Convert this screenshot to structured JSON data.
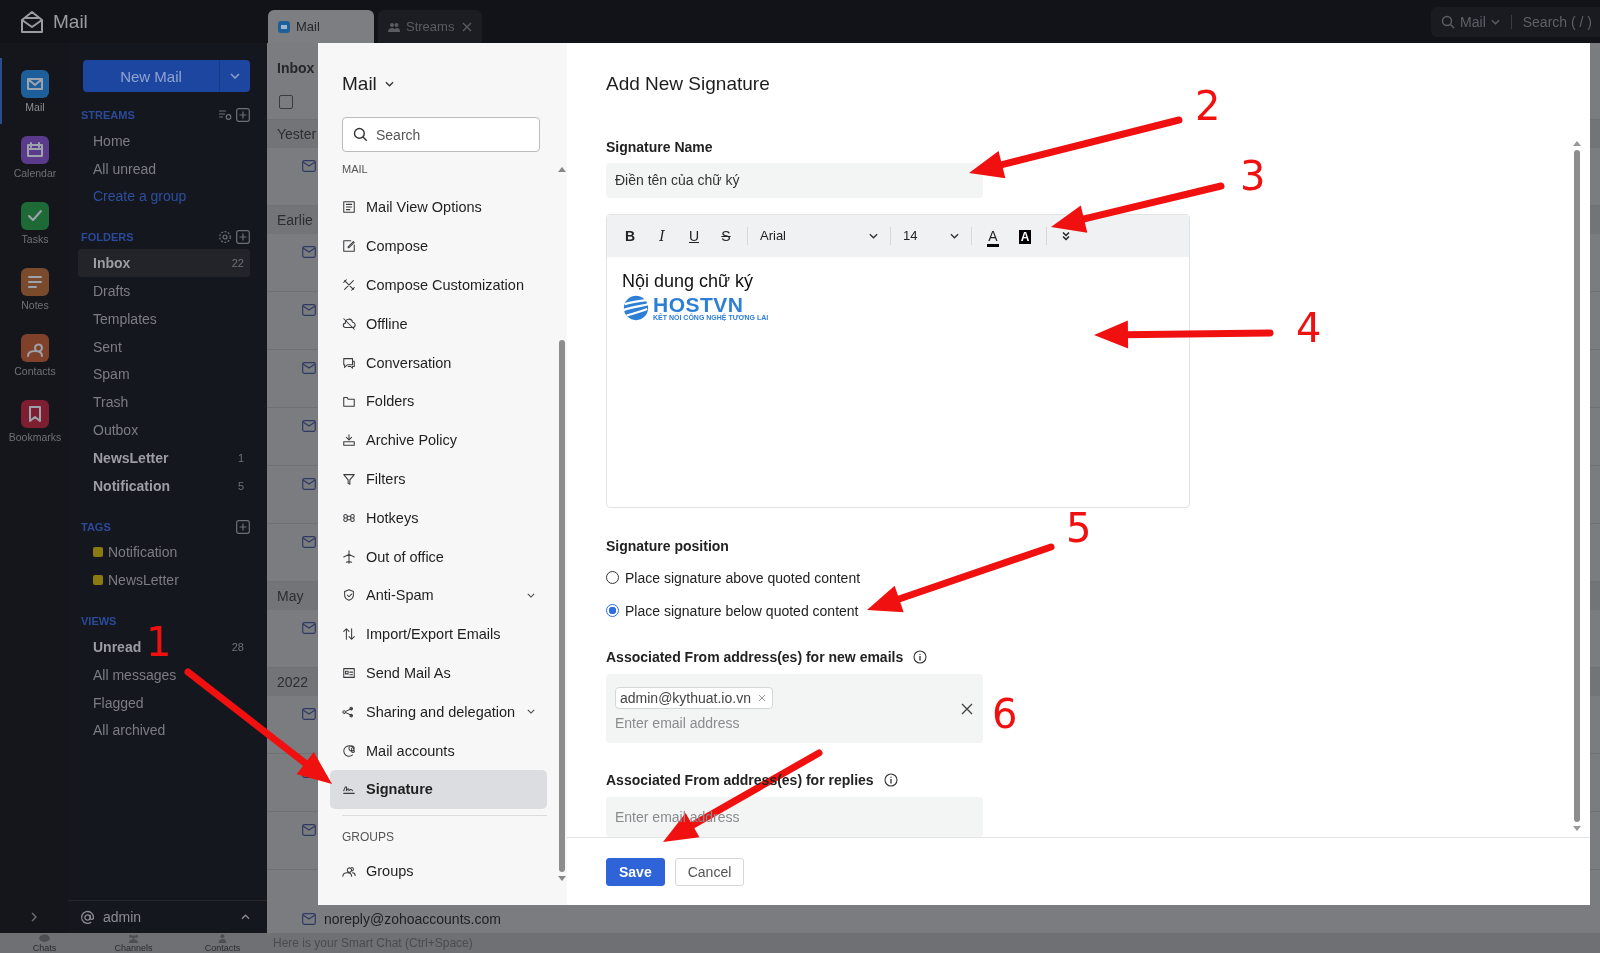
{
  "app": {
    "name": "Mail"
  },
  "top_tabs": [
    {
      "label": "Mail",
      "selected": true
    },
    {
      "label": "Streams",
      "selected": false
    }
  ],
  "top_search": {
    "scope": "Mail",
    "placeholder": "Search ( / )"
  },
  "app_rail": [
    {
      "label": "Mail",
      "selected": true,
      "color": "#1d5f9a"
    },
    {
      "label": "Calendar",
      "selected": false,
      "color": "#5b3a8c"
    },
    {
      "label": "Tasks",
      "selected": false,
      "color": "#1d6a36"
    },
    {
      "label": "Notes",
      "selected": false,
      "color": "#7a4a2c"
    },
    {
      "label": "Contacts",
      "selected": false,
      "color": "#80412a"
    },
    {
      "label": "Bookmarks",
      "selected": false,
      "color": "#7d1f30"
    }
  ],
  "new_mail_button": "New Mail",
  "streams": {
    "title": "STREAMS",
    "items": [
      {
        "label": "Home",
        "kind": "item"
      },
      {
        "label": "All unread",
        "kind": "item"
      },
      {
        "label": "Create a group",
        "kind": "link"
      }
    ]
  },
  "folders": {
    "title": "FOLDERS",
    "items": [
      {
        "label": "Inbox",
        "count": "22",
        "selected": true,
        "unread": true
      },
      {
        "label": "Drafts",
        "selected": false,
        "unread": false
      },
      {
        "label": "Templates",
        "selected": false,
        "unread": false
      },
      {
        "label": "Sent",
        "selected": false,
        "unread": false
      },
      {
        "label": "Spam",
        "selected": false,
        "unread": false
      },
      {
        "label": "Trash",
        "selected": false,
        "unread": false
      },
      {
        "label": "Outbox",
        "selected": false,
        "unread": false
      },
      {
        "label": "NewsLetter",
        "count": "1",
        "selected": false,
        "unread": true
      },
      {
        "label": "Notification",
        "count": "5",
        "selected": false,
        "unread": true
      }
    ]
  },
  "tags": {
    "title": "TAGS",
    "items": [
      {
        "label": "Notification",
        "color": "#8a7a12"
      },
      {
        "label": "NewsLetter",
        "color": "#8a7a12"
      }
    ]
  },
  "views": {
    "title": "VIEWS",
    "items": [
      {
        "label": "Unread",
        "count": "28",
        "unread": true
      },
      {
        "label": "All messages",
        "unread": false
      },
      {
        "label": "Flagged",
        "unread": false
      },
      {
        "label": "All archived",
        "unread": false
      }
    ]
  },
  "account": {
    "name": "admin"
  },
  "chat_bar": {
    "items": [
      "Chats",
      "Channels",
      "Contacts"
    ],
    "placeholder": "Here is your Smart Chat (Ctrl+Space)"
  },
  "mail_list": {
    "title": "Inbox",
    "select_all_checked": false,
    "groups": [
      "Yester",
      "Earlie",
      "May",
      "2022"
    ],
    "last_sender": "noreply@zohoaccounts.com"
  },
  "settings_nav": {
    "title": "Mail",
    "search_placeholder": "Search",
    "sections": [
      {
        "title": "MAIL",
        "items": [
          {
            "label": "Mail View Options",
            "selected": false,
            "expandable": false
          },
          {
            "label": "Compose",
            "selected": false,
            "expandable": false
          },
          {
            "label": "Compose Customization",
            "selected": false,
            "expandable": false
          },
          {
            "label": "Offline",
            "selected": false,
            "expandable": false
          },
          {
            "label": "Conversation",
            "selected": false,
            "expandable": false
          },
          {
            "label": "Folders",
            "selected": false,
            "expandable": false
          },
          {
            "label": "Archive Policy",
            "selected": false,
            "expandable": false
          },
          {
            "label": "Filters",
            "selected": false,
            "expandable": false
          },
          {
            "label": "Hotkeys",
            "selected": false,
            "expandable": false
          },
          {
            "label": "Out of office",
            "selected": false,
            "expandable": false
          },
          {
            "label": "Anti-Spam",
            "selected": false,
            "expandable": true
          },
          {
            "label": "Import/Export Emails",
            "selected": false,
            "expandable": false
          },
          {
            "label": "Send Mail As",
            "selected": false,
            "expandable": false
          },
          {
            "label": "Sharing and delegation",
            "selected": false,
            "expandable": true
          },
          {
            "label": "Mail accounts",
            "selected": false,
            "expandable": false
          },
          {
            "label": "Signature",
            "selected": true,
            "expandable": false
          }
        ]
      },
      {
        "title": "GROUPS",
        "items": [
          {
            "label": "Groups",
            "selected": false,
            "expandable": false
          }
        ]
      }
    ]
  },
  "signature_form": {
    "title": "Add New Signature",
    "name_label": "Signature Name",
    "name_value": "Điền tên của chữ ký",
    "toolbar": {
      "format": [
        "B",
        "I",
        "U",
        "S"
      ],
      "font": "Arial",
      "size": "14",
      "colors": [
        "A",
        "A"
      ]
    },
    "content": "Nội dung chữ ký",
    "logo": {
      "name": "HOSTVN",
      "tagline": "KẾT NỐI CÔNG NGHỆ TƯƠNG LAI"
    },
    "position_label": "Signature position",
    "position_options": [
      {
        "label": "Place signature above quoted content",
        "selected": false
      },
      {
        "label": "Place signature below quoted content",
        "selected": true
      }
    ],
    "new_emails": {
      "label": "Associated From address(es) for new emails",
      "chips": [
        "admin@kythuat.io.vn"
      ],
      "placeholder": "Enter email address"
    },
    "replies": {
      "label": "Associated From address(es) for replies",
      "placeholder": "Enter email address"
    },
    "buttons": [
      {
        "label": "Save",
        "kind": "primary"
      },
      {
        "label": "Cancel",
        "kind": "secondary"
      }
    ]
  },
  "annotations": [
    "1",
    "2",
    "3",
    "4",
    "5",
    "6"
  ]
}
